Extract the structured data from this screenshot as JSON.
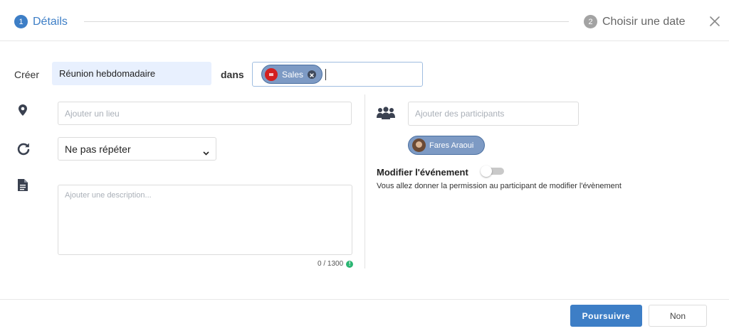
{
  "stepper": {
    "step1": {
      "number": "1",
      "label": "Détails"
    },
    "step2": {
      "number": "2",
      "label": "Choisir une date"
    },
    "close_icon": "close-icon"
  },
  "form": {
    "create_label": "Créer",
    "title_value": "Réunion hebdomadaire",
    "in_label": "dans",
    "calendar_chip": "Sales",
    "location": {
      "placeholder": "Ajouter un lieu",
      "value": "",
      "icon": "map-pin-icon"
    },
    "repeat": {
      "selected": "Ne pas répéter",
      "icon": "repeat-icon"
    },
    "description": {
      "placeholder": "Ajouter une description...",
      "value": "",
      "icon": "document-icon",
      "counter": "0 / 1300"
    }
  },
  "participants": {
    "icon": "users-icon",
    "placeholder": "Ajouter des participants",
    "chips": [
      {
        "name": "Fares Araoui"
      }
    ],
    "modify_label": "Modifier l'événement",
    "modify_enabled": false,
    "permission_text": "Vous allez donner la permission au participant de modifier l'évènement"
  },
  "footer": {
    "continue_label": "Poursuivre",
    "no_label": "Non"
  },
  "colors": {
    "primary": "#3d7ec6",
    "chip_bg": "#7d9ac4",
    "calendar_logo": "#d31f1f",
    "info_green": "#2bb673"
  }
}
